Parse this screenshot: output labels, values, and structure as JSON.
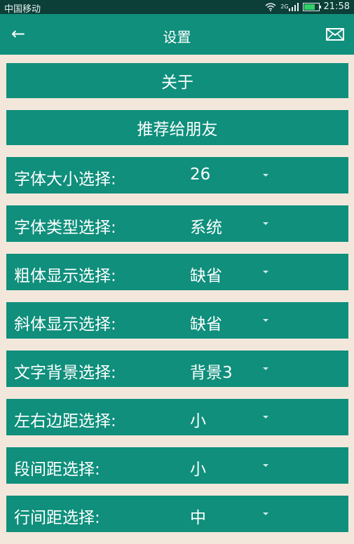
{
  "status": {
    "carrier": "中国移动",
    "network": "2G",
    "time": "21:58",
    "battery_level": 0.7
  },
  "appbar": {
    "title": "设置",
    "back_icon": "arrow-left-icon",
    "mail_icon": "mail-icon"
  },
  "buttons": {
    "about": "关于",
    "recommend": "推荐给朋友"
  },
  "rows": [
    {
      "label": "字体大小选择:",
      "value": "26"
    },
    {
      "label": "字体类型选择:",
      "value": "系统"
    },
    {
      "label": "粗体显示选择:",
      "value": "缺省"
    },
    {
      "label": "斜体显示选择:",
      "value": "缺省"
    },
    {
      "label": "文字背景选择:",
      "value": "背景3"
    },
    {
      "label": "左右边距选择:",
      "value": "小"
    },
    {
      "label": "段间距选择:",
      "value": "小"
    },
    {
      "label": "行间距选择:",
      "value": "中"
    }
  ],
  "colors": {
    "primary": "#0f8f7c",
    "statusbar": "#0b3f38",
    "background": "#f3e7dc"
  }
}
